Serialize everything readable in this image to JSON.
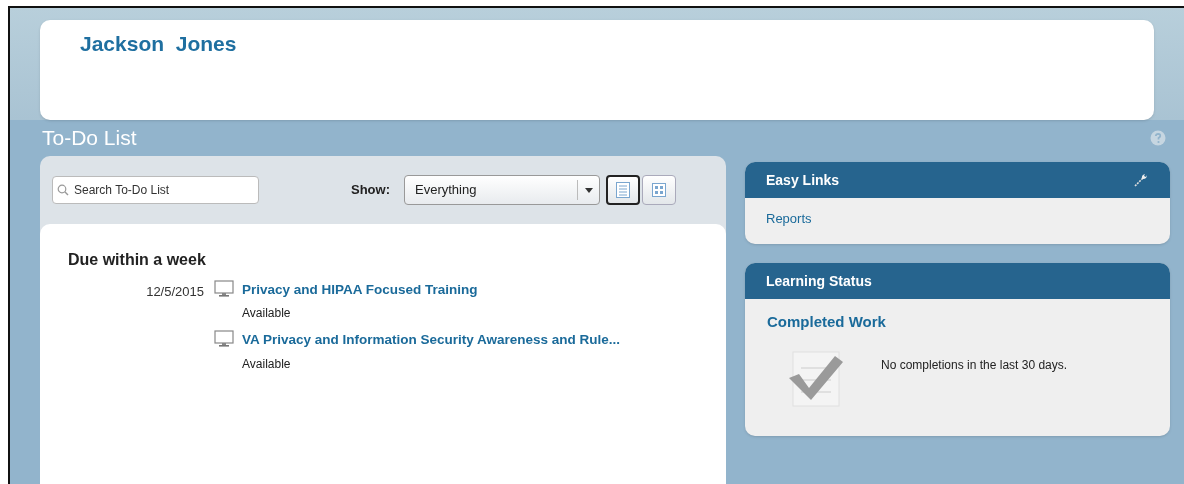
{
  "header": {
    "user_name": "Jackson  Jones"
  },
  "page_title": "To-Do List",
  "todo": {
    "search": {
      "placeholder": "Search To-Do List"
    },
    "show_label": "Show:",
    "show_value": "Everything",
    "view_buttons": [
      {
        "kind": "list",
        "selected": true
      },
      {
        "kind": "grid",
        "selected": false
      }
    ],
    "groups": [
      {
        "title": "Due within a week",
        "items": [
          {
            "date": "12/5/2015",
            "title": "Privacy and HIPAA Focused Training",
            "status": "Available"
          },
          {
            "title": "VA Privacy and Information Security Awareness and Rule...",
            "status": "Available"
          }
        ]
      }
    ]
  },
  "easy_links": {
    "title": "Easy Links",
    "links": [
      "Reports"
    ]
  },
  "learning_status": {
    "title": "Learning Status",
    "subtitle": "Completed Work",
    "message": "No completions in the last 30 days."
  }
}
